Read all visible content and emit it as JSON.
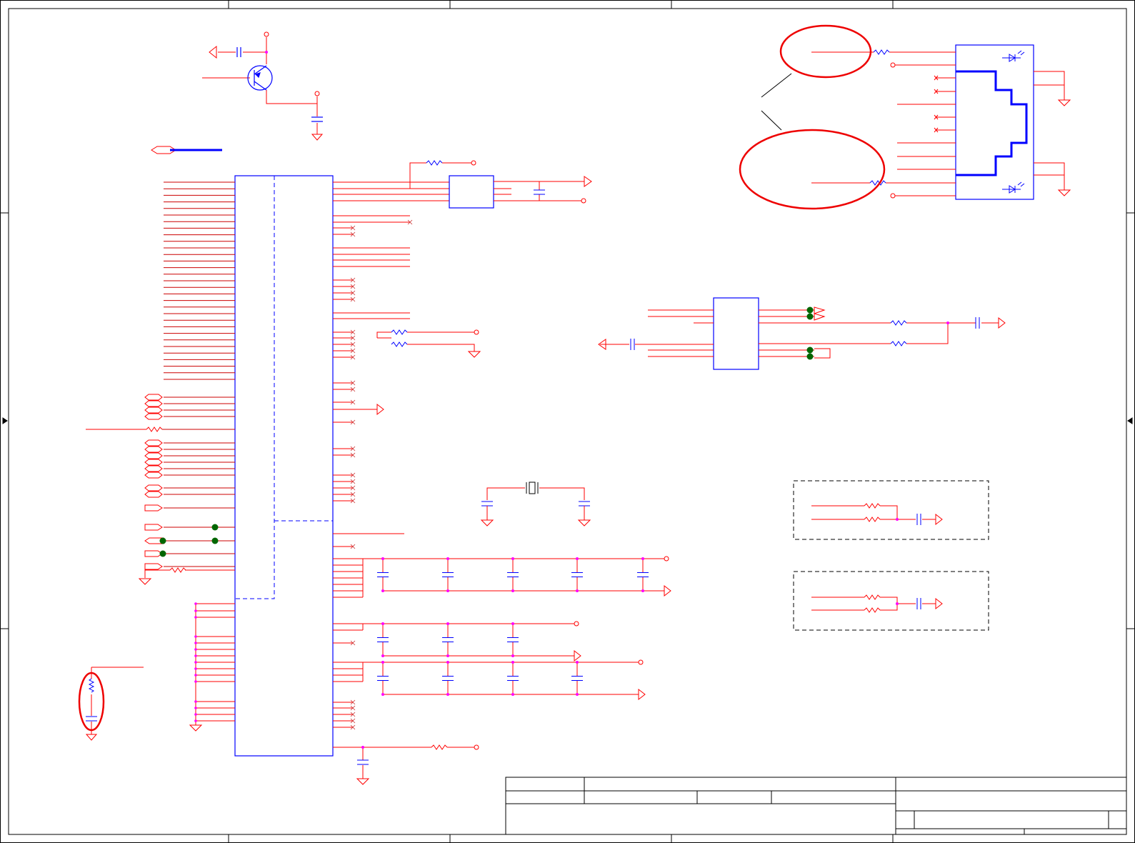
{
  "schematic": {
    "colors": {
      "wire": "#ff0000",
      "component": "#0000ff",
      "frame": "#000000",
      "junction": "#ff00ff",
      "annotation_ring": "#ee0000",
      "testpoint": "#006600"
    },
    "title_block": {
      "visible_text": []
    }
  }
}
